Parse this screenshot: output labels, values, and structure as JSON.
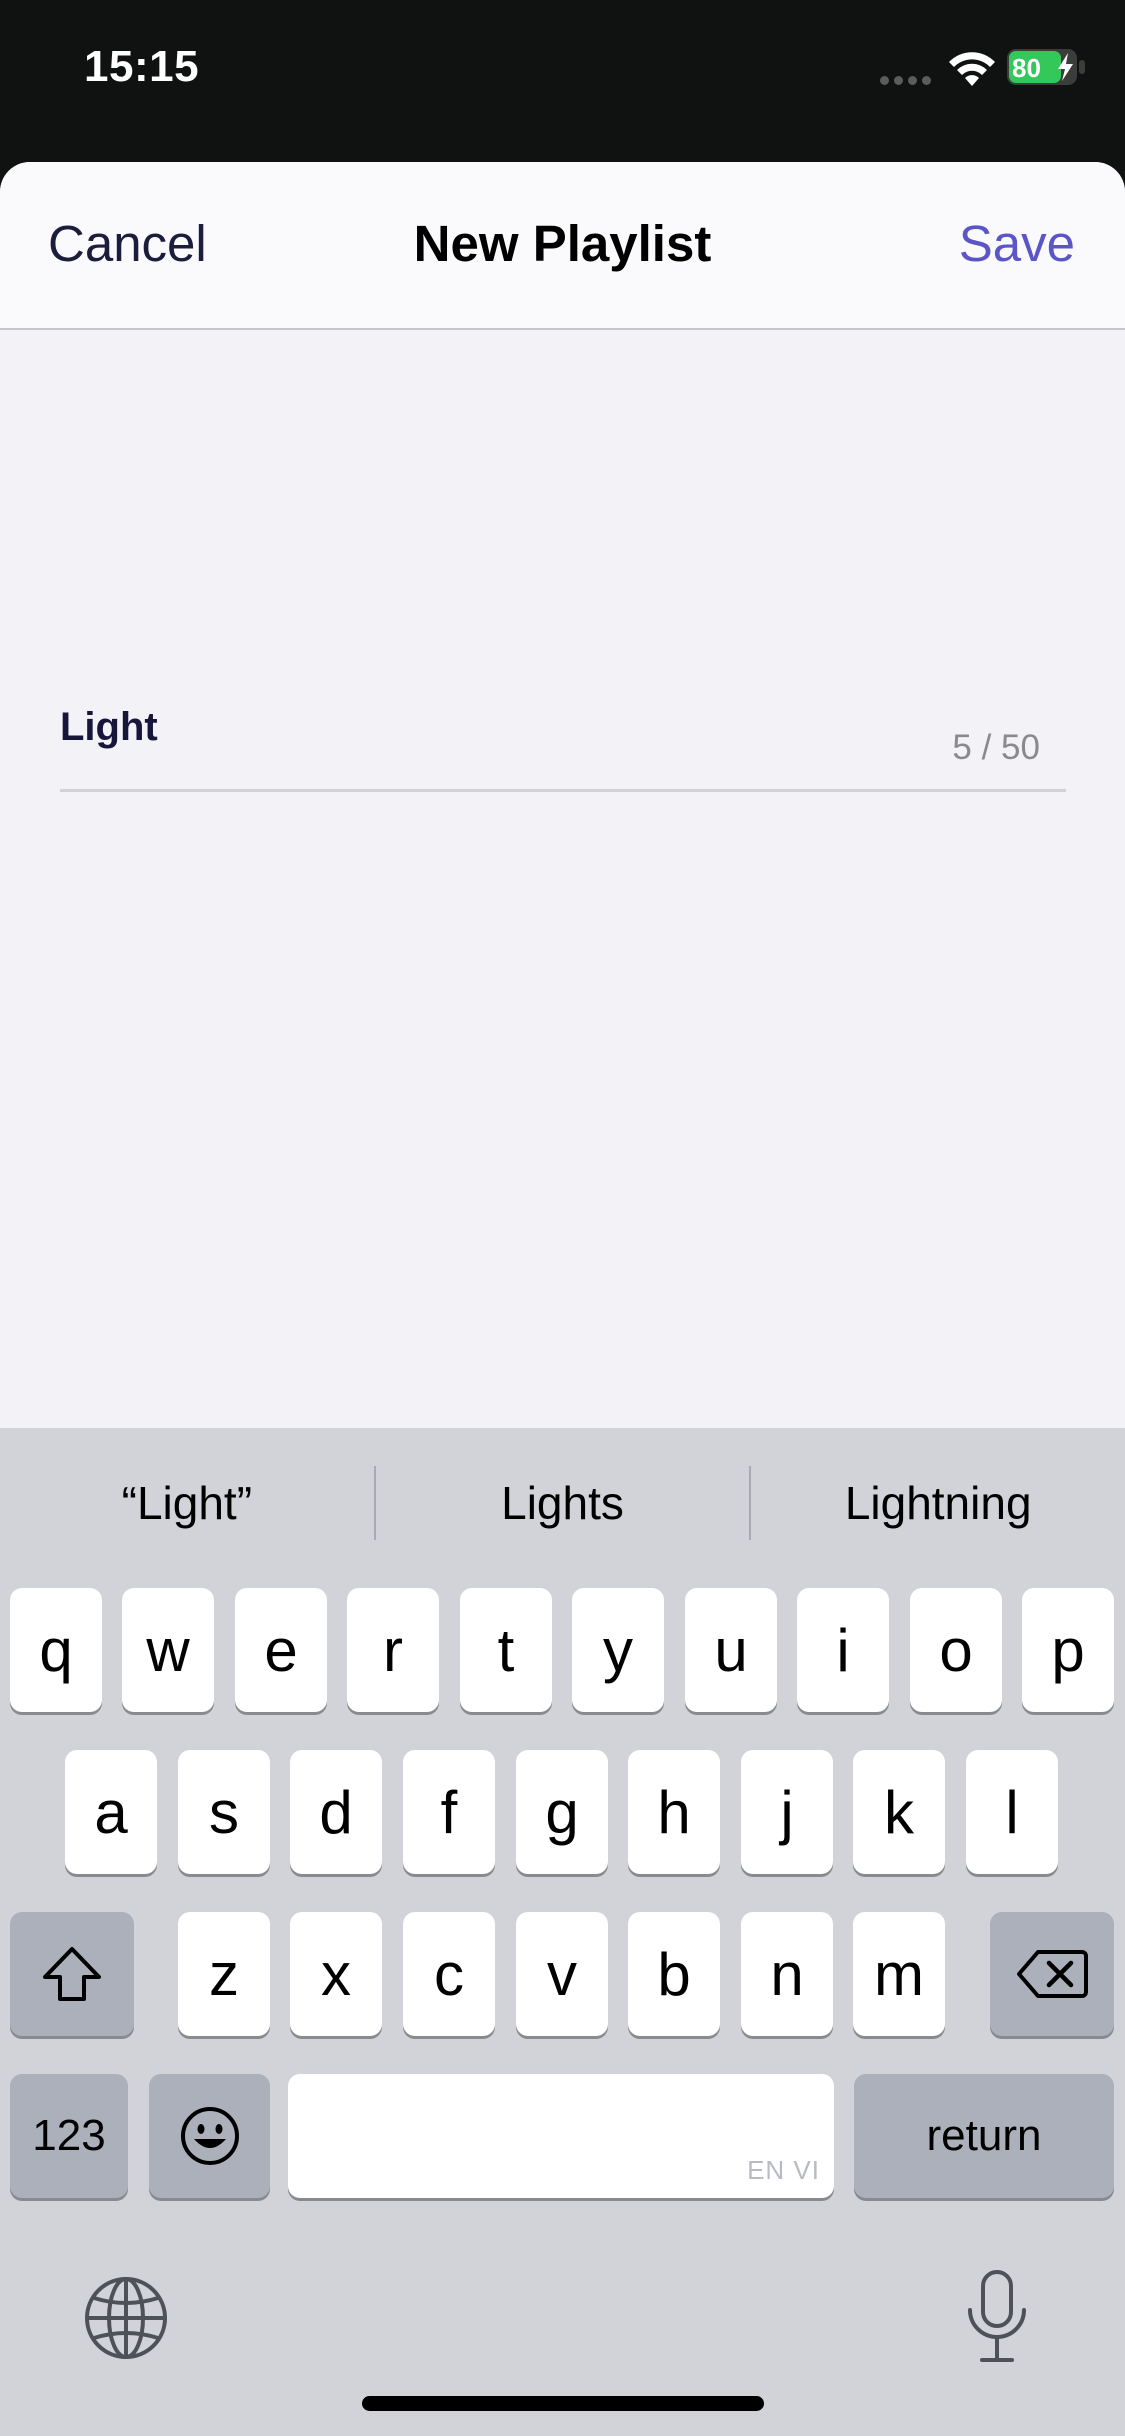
{
  "status_bar": {
    "time": "15:15",
    "battery_level": "80",
    "icons": [
      "signal-dots-icon",
      "wifi-icon",
      "battery-charging-icon"
    ]
  },
  "nav": {
    "cancel_label": "Cancel",
    "title": "New Playlist",
    "save_label": "Save"
  },
  "playlist_name": {
    "value": "Light",
    "counter": "5 / 50"
  },
  "keyboard": {
    "suggestions": [
      "“Light”",
      "Lights",
      "Lightning"
    ],
    "row1": [
      "q",
      "w",
      "e",
      "r",
      "t",
      "y",
      "u",
      "i",
      "o",
      "p"
    ],
    "row2": [
      "a",
      "s",
      "d",
      "f",
      "g",
      "h",
      "j",
      "k",
      "l"
    ],
    "row3": [
      "z",
      "x",
      "c",
      "v",
      "b",
      "n",
      "m"
    ],
    "numbers_label": "123",
    "space_language": "EN VI",
    "return_label": "return",
    "icons": [
      "shift-icon",
      "backspace-icon",
      "emoji-icon",
      "globe-icon",
      "microphone-icon"
    ]
  },
  "colors": {
    "accent": "#5b55c8",
    "sheet_background": "#f2f2f7",
    "keyboard_background": "#d1d3d9",
    "battery_fill": "#34c759"
  }
}
